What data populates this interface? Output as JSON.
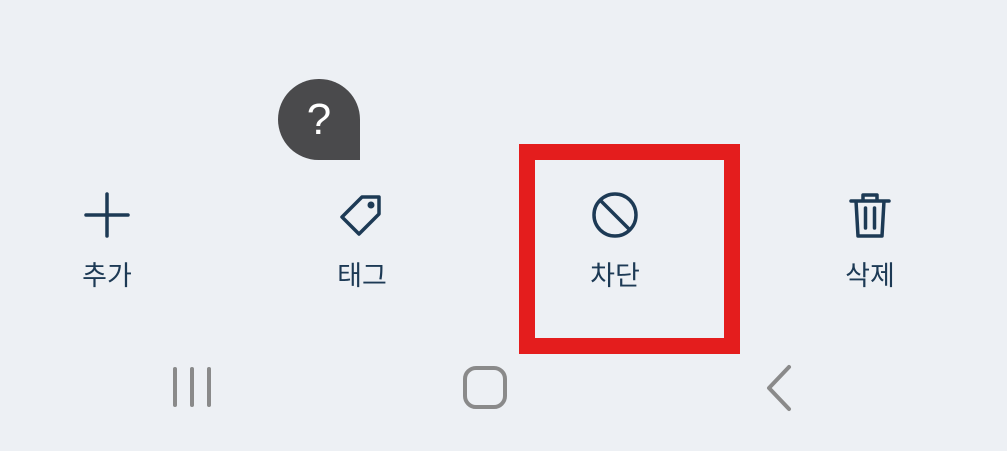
{
  "help": {
    "symbol": "?"
  },
  "actions": [
    {
      "label": "추가",
      "icon": "plus-icon"
    },
    {
      "label": "태그",
      "icon": "tag-icon"
    },
    {
      "label": "차단",
      "icon": "block-icon"
    },
    {
      "label": "삭제",
      "icon": "trash-icon"
    }
  ],
  "nav": [
    {
      "icon": "recent-apps-icon"
    },
    {
      "icon": "home-icon"
    },
    {
      "icon": "back-icon"
    }
  ],
  "colors": {
    "background": "#edf0f4",
    "icon": "#1d3a55",
    "highlight": "#e41d1d",
    "nav_icon": "#8a8a8a",
    "help_bubble": "#4a4a4c"
  }
}
